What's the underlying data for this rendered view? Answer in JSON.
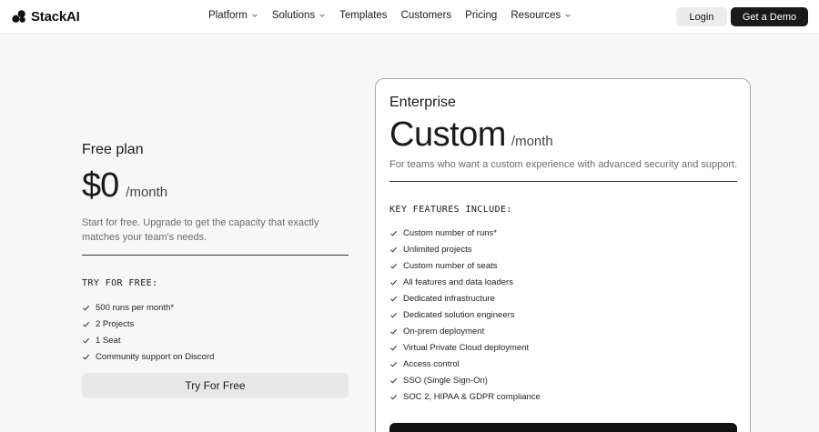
{
  "header": {
    "brand": "StackAI",
    "nav": [
      {
        "label": "Platform",
        "dropdown": true
      },
      {
        "label": "Solutions",
        "dropdown": true
      },
      {
        "label": "Templates",
        "dropdown": false
      },
      {
        "label": "Customers",
        "dropdown": false
      },
      {
        "label": "Pricing",
        "dropdown": false
      },
      {
        "label": "Resources",
        "dropdown": true
      }
    ],
    "login_label": "Login",
    "demo_label": "Get a Demo"
  },
  "free_plan": {
    "name": "Free plan",
    "price": "$0",
    "period": "/month",
    "description": "Start for free. Upgrade to get the capacity that exactly matches your team's needs.",
    "features_heading": "TRY FOR FREE:",
    "features": [
      "500 runs per month*",
      "2 Projects",
      "1 Seat",
      "Community support on Discord"
    ],
    "cta_label": "Try For Free"
  },
  "enterprise_plan": {
    "name": "Enterprise",
    "price": "Custom",
    "period": "/month",
    "description": "For teams who want a custom experience with advanced security and support.",
    "features_heading": "KEY FEATURES INCLUDE:",
    "features": [
      "Custom number of runs*",
      "Unlimited projects",
      "Custom number of seats",
      "All features and data loaders",
      "Dedicated infrastructure",
      "Dedicated solution engineers",
      "On-prem deployment",
      "Virtual Private Cloud deployment",
      "Access control",
      "SSO (Single Sign-On)",
      "SOC 2, HIPAA & GDPR compliance"
    ]
  },
  "colors": {
    "background": "#f7f7f7",
    "dark_button": "#1a1a1a",
    "light_button": "#e8e8e8"
  }
}
